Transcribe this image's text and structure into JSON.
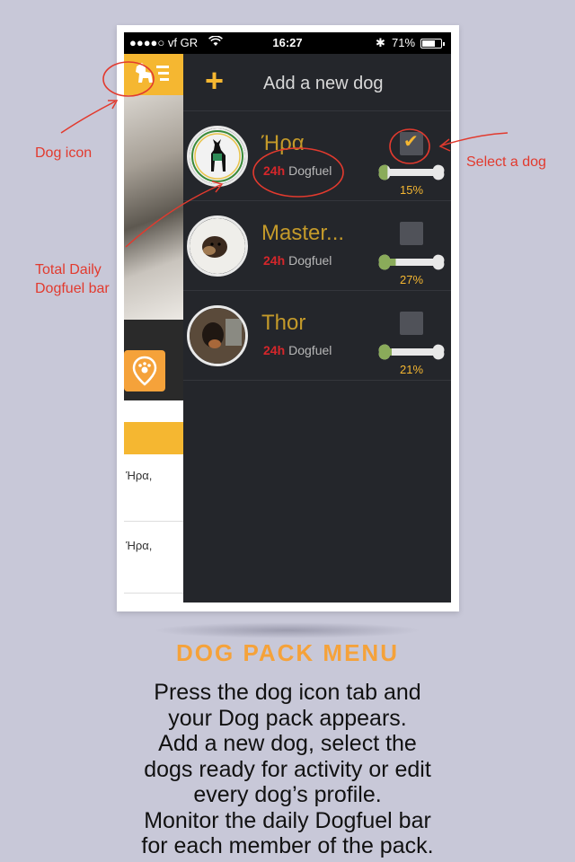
{
  "status_bar": {
    "carrier": "●●●●○ vf GR",
    "time": "16:27",
    "battery": "71%",
    "battery_level": 0.71
  },
  "background_app": {
    "row_texts": [
      "Ήρα,",
      "Ήρα,"
    ]
  },
  "drawer": {
    "add_label": "Add a new dog",
    "dogs": [
      {
        "name": "Ήρα",
        "hours": "24h",
        "fuel_label": "Dogfuel",
        "selected": true,
        "fuel_percent": "15%",
        "fuel_value": 0.15
      },
      {
        "name": "Master...",
        "hours": "24h",
        "fuel_label": "Dogfuel",
        "selected": false,
        "fuel_percent": "27%",
        "fuel_value": 0.27
      },
      {
        "name": "Thor",
        "hours": "24h",
        "fuel_label": "Dogfuel",
        "selected": false,
        "fuel_percent": "21%",
        "fuel_value": 0.21
      }
    ]
  },
  "annotations": {
    "dog_icon": "Dog icon",
    "select_dog": "Select a dog",
    "total_daily": "Total Daily",
    "dogfuel_bar": "Dogfuel bar"
  },
  "caption": {
    "title": "DOG PACK MENU",
    "lines": [
      "Press the dog icon tab and",
      "your Dog pack appears.",
      "Add a new dog, select the",
      "dogs ready for activity or edit",
      "every dog’s profile.",
      "Monitor the daily Dogfuel bar",
      "for each member of the pack."
    ]
  },
  "colors": {
    "accent": "#f5b731",
    "drawer_bg": "#24262b",
    "annotation": "#e23a2e",
    "dog_name": "#c49a2a",
    "hours_red": "#d6262b",
    "bone_green": "#8aab5a"
  }
}
